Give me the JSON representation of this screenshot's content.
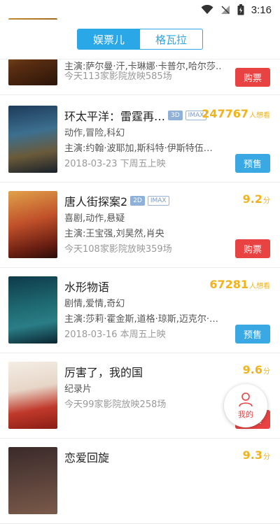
{
  "status": {
    "time": "3:16"
  },
  "tabs": [
    {
      "label": "娱票儿",
      "active": true
    },
    {
      "label": "格瓦拉",
      "active": false
    }
  ],
  "movies": [
    {
      "title": "",
      "cast": "主演:萨尔曼·汗,卡琳娜·卡普尔,哈尔莎…",
      "info": "今天113家影院放映585场",
      "button": "购票"
    },
    {
      "title": "环太平洋：雷霆再…",
      "badges": [
        "3D",
        "IMAX"
      ],
      "score": "247767",
      "score_unit": "人想看",
      "genre": "动作,冒险,科幻",
      "cast": "主演:约翰·波耶加,斯科特·伊斯特伍…",
      "info": "2018-03-23 下周五上映",
      "button": "预售"
    },
    {
      "title": "唐人街探案2",
      "badges": [
        "2D",
        "IMAX"
      ],
      "score": "9.2",
      "score_unit": "分",
      "genre": "喜剧,动作,悬疑",
      "cast": "主演:王宝强,刘昊然,肖央",
      "info": "今天108家影院放映359场",
      "button": "购票"
    },
    {
      "title": "水形物语",
      "badges": [],
      "score": "67281",
      "score_unit": "人想看",
      "genre": "剧情,爱情,奇幻",
      "cast": "主演:莎莉·霍金斯,道格·琼斯,迈克尔·…",
      "info": "2018-03-16 本周五上映",
      "button": "预售"
    },
    {
      "title": "厉害了，我的国",
      "badges": [],
      "score": "9.6",
      "score_unit": "分",
      "genre": "纪录片",
      "info": "今天99家影院放映258场",
      "button": "购票"
    },
    {
      "title": "恋爱回旋",
      "score": "9.3",
      "score_unit": "分"
    }
  ],
  "float_button": {
    "label": "我的",
    "icon": "user-icon"
  },
  "colors": {
    "accent": "#2aa7e6",
    "buy": "#e84242",
    "presale": "#3aa9e3",
    "score": "#f0b31b"
  }
}
